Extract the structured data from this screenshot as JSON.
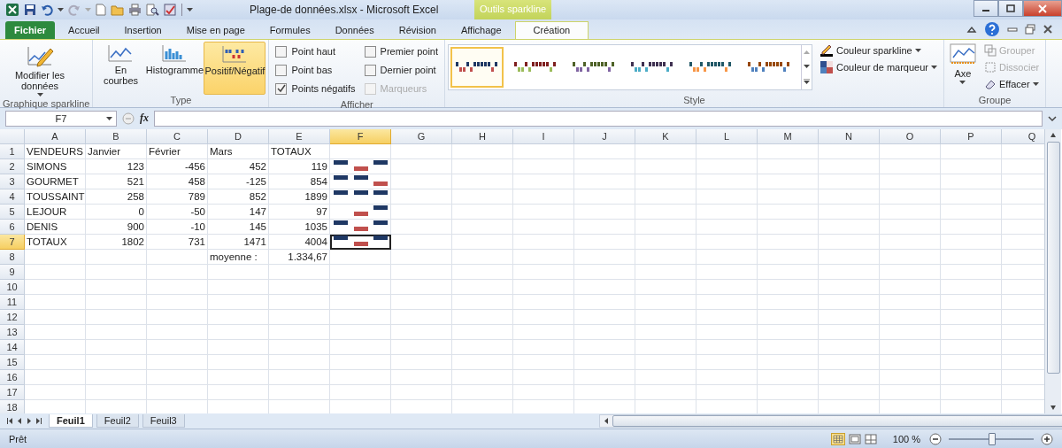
{
  "window": {
    "title": "Plage-de données.xlsx  -  Microsoft Excel",
    "context_tab": "Outils sparkline"
  },
  "file_tab": "Fichier",
  "tabs": [
    {
      "label": "Accueil",
      "selected": false
    },
    {
      "label": "Insertion",
      "selected": false
    },
    {
      "label": "Mise en page",
      "selected": false
    },
    {
      "label": "Formules",
      "selected": false
    },
    {
      "label": "Données",
      "selected": false
    },
    {
      "label": "Révision",
      "selected": false
    },
    {
      "label": "Affichage",
      "selected": false
    },
    {
      "label": "Création",
      "selected": true
    }
  ],
  "ribbon": {
    "sparkline_group": {
      "label": "Graphique sparkline",
      "button": "Modifier les données"
    },
    "type_group": {
      "label": "Type",
      "buttons": [
        {
          "label": "En courbes",
          "kind": "line",
          "selected": false
        },
        {
          "label": "Histogramme",
          "kind": "column",
          "selected": false
        },
        {
          "label": "Positif/Négatif",
          "kind": "winloss",
          "selected": true
        }
      ]
    },
    "show_group": {
      "label": "Afficher",
      "options": [
        {
          "label": "Point haut",
          "checked": false,
          "disabled": false
        },
        {
          "label": "Point bas",
          "checked": false,
          "disabled": false
        },
        {
          "label": "Points négatifs",
          "checked": true,
          "disabled": false
        },
        {
          "label": "Premier point",
          "checked": false,
          "disabled": false
        },
        {
          "label": "Dernier point",
          "checked": false,
          "disabled": false
        },
        {
          "label": "Marqueurs",
          "checked": false,
          "disabled": true
        }
      ]
    },
    "style_group": {
      "label": "Style",
      "styles": [
        {
          "selected": true,
          "series": [
            {
              "color": "#1f3864"
            },
            {
              "color": "#c0504d"
            }
          ]
        },
        {
          "selected": false,
          "series": [
            {
              "color": "#7f1f1f"
            },
            {
              "color": "#9bbb59"
            }
          ]
        },
        {
          "selected": false,
          "series": [
            {
              "color": "#4f6228"
            },
            {
              "color": "#8064a2"
            }
          ]
        },
        {
          "selected": false,
          "series": [
            {
              "color": "#3f3151"
            },
            {
              "color": "#4bacc6"
            }
          ]
        },
        {
          "selected": false,
          "series": [
            {
              "color": "#215867"
            },
            {
              "color": "#f79646"
            }
          ]
        },
        {
          "selected": false,
          "series": [
            {
              "color": "#974806"
            },
            {
              "color": "#4f81bd"
            }
          ]
        }
      ],
      "sparkline_color": "Couleur sparkline",
      "marker_color": "Couleur de marqueur"
    },
    "group_group": {
      "label": "Groupe",
      "axis": "Axe",
      "group": "Grouper",
      "ungroup": "Dissocier",
      "clear": "Effacer"
    }
  },
  "formula_bar": {
    "name_box": "F7",
    "function_label": "fx"
  },
  "columns": [
    {
      "label": "A",
      "selected": false
    },
    {
      "label": "B",
      "selected": false
    },
    {
      "label": "C",
      "selected": false
    },
    {
      "label": "D",
      "selected": false
    },
    {
      "label": "E",
      "selected": false
    },
    {
      "label": "F",
      "selected": true
    },
    {
      "label": "G",
      "selected": false
    },
    {
      "label": "H",
      "selected": false
    },
    {
      "label": "I",
      "selected": false
    },
    {
      "label": "J",
      "selected": false
    },
    {
      "label": "K",
      "selected": false
    },
    {
      "label": "L",
      "selected": false
    },
    {
      "label": "M",
      "selected": false
    },
    {
      "label": "N",
      "selected": false
    },
    {
      "label": "O",
      "selected": false
    },
    {
      "label": "P",
      "selected": false
    },
    {
      "label": "Q",
      "selected": false
    }
  ],
  "rows": [
    {
      "number": "1",
      "selected": false,
      "cells": [
        {
          "text": "VENDEURS",
          "kind": "text"
        },
        {
          "text": "Janvier",
          "kind": "text"
        },
        {
          "text": "Février",
          "kind": "text"
        },
        {
          "text": "Mars",
          "kind": "text"
        },
        {
          "text": "TOTAUX",
          "kind": "text"
        }
      ]
    },
    {
      "number": "2",
      "selected": false,
      "cells": [
        {
          "text": "SIMONS",
          "kind": "text"
        },
        {
          "text": "123",
          "kind": "number"
        },
        {
          "text": "-456",
          "kind": "number"
        },
        {
          "text": "452",
          "kind": "number"
        },
        {
          "text": "119",
          "kind": "number"
        }
      ],
      "sparkline": [
        {
          "kind": "positive"
        },
        {
          "kind": "negative"
        },
        {
          "kind": "positive"
        }
      ]
    },
    {
      "number": "3",
      "selected": false,
      "cells": [
        {
          "text": "GOURMET",
          "kind": "text"
        },
        {
          "text": "521",
          "kind": "number"
        },
        {
          "text": "458",
          "kind": "number"
        },
        {
          "text": "-125",
          "kind": "number"
        },
        {
          "text": "854",
          "kind": "number"
        }
      ],
      "sparkline": [
        {
          "kind": "positive"
        },
        {
          "kind": "positive"
        },
        {
          "kind": "negative"
        }
      ]
    },
    {
      "number": "4",
      "selected": false,
      "cells": [
        {
          "text": "TOUSSAINT",
          "kind": "text"
        },
        {
          "text": "258",
          "kind": "number"
        },
        {
          "text": "789",
          "kind": "number"
        },
        {
          "text": "852",
          "kind": "number"
        },
        {
          "text": "1899",
          "kind": "number"
        }
      ],
      "sparkline": [
        {
          "kind": "positive"
        },
        {
          "kind": "positive"
        },
        {
          "kind": "positive"
        }
      ]
    },
    {
      "number": "5",
      "selected": false,
      "cells": [
        {
          "text": "LEJOUR",
          "kind": "text"
        },
        {
          "text": "0",
          "kind": "number"
        },
        {
          "text": "-50",
          "kind": "number"
        },
        {
          "text": "147",
          "kind": "number"
        },
        {
          "text": "97",
          "kind": "number"
        }
      ],
      "sparkline": [
        {
          "kind": "zero"
        },
        {
          "kind": "negative"
        },
        {
          "kind": "positive"
        }
      ]
    },
    {
      "number": "6",
      "selected": false,
      "cells": [
        {
          "text": "DENIS",
          "kind": "text"
        },
        {
          "text": "900",
          "kind": "number"
        },
        {
          "text": "-10",
          "kind": "number"
        },
        {
          "text": "145",
          "kind": "number"
        },
        {
          "text": "1035",
          "kind": "number"
        }
      ],
      "sparkline": [
        {
          "kind": "positive"
        },
        {
          "kind": "negative"
        },
        {
          "kind": "positive"
        }
      ]
    },
    {
      "number": "7",
      "selected": true,
      "cells": [
        {
          "text": "TOTAUX",
          "kind": "text"
        },
        {
          "text": "1802",
          "kind": "number"
        },
        {
          "text": "731",
          "kind": "number"
        },
        {
          "text": "1471",
          "kind": "number"
        },
        {
          "text": "4004",
          "kind": "number"
        }
      ],
      "sparkline": [
        {
          "kind": "positive"
        },
        {
          "kind": "negative"
        },
        {
          "kind": "positive"
        }
      ],
      "sparkline_selected": true
    },
    {
      "number": "8",
      "selected": false,
      "cells": [
        null,
        null,
        null,
        {
          "text": "moyenne :",
          "kind": "text"
        },
        {
          "text": "1.334,67",
          "kind": "number"
        }
      ]
    },
    {
      "number": "9",
      "selected": false,
      "cells": []
    },
    {
      "number": "10",
      "selected": false,
      "cells": []
    },
    {
      "number": "11",
      "selected": false,
      "cells": []
    },
    {
      "number": "12",
      "selected": false,
      "cells": []
    },
    {
      "number": "13",
      "selected": false,
      "cells": []
    },
    {
      "number": "14",
      "selected": false,
      "cells": []
    },
    {
      "number": "15",
      "selected": false,
      "cells": []
    },
    {
      "number": "16",
      "selected": false,
      "cells": []
    },
    {
      "number": "17",
      "selected": false,
      "cells": []
    },
    {
      "number": "18",
      "selected": false,
      "cells": []
    }
  ],
  "sheet_tabs": [
    {
      "label": "Feuil1",
      "selected": true
    },
    {
      "label": "Feuil2",
      "selected": false
    },
    {
      "label": "Feuil3",
      "selected": false
    }
  ],
  "status_bar": {
    "status": "Prêt",
    "zoom": "100 %",
    "zoom_level": {
      "level": 0.5
    }
  }
}
